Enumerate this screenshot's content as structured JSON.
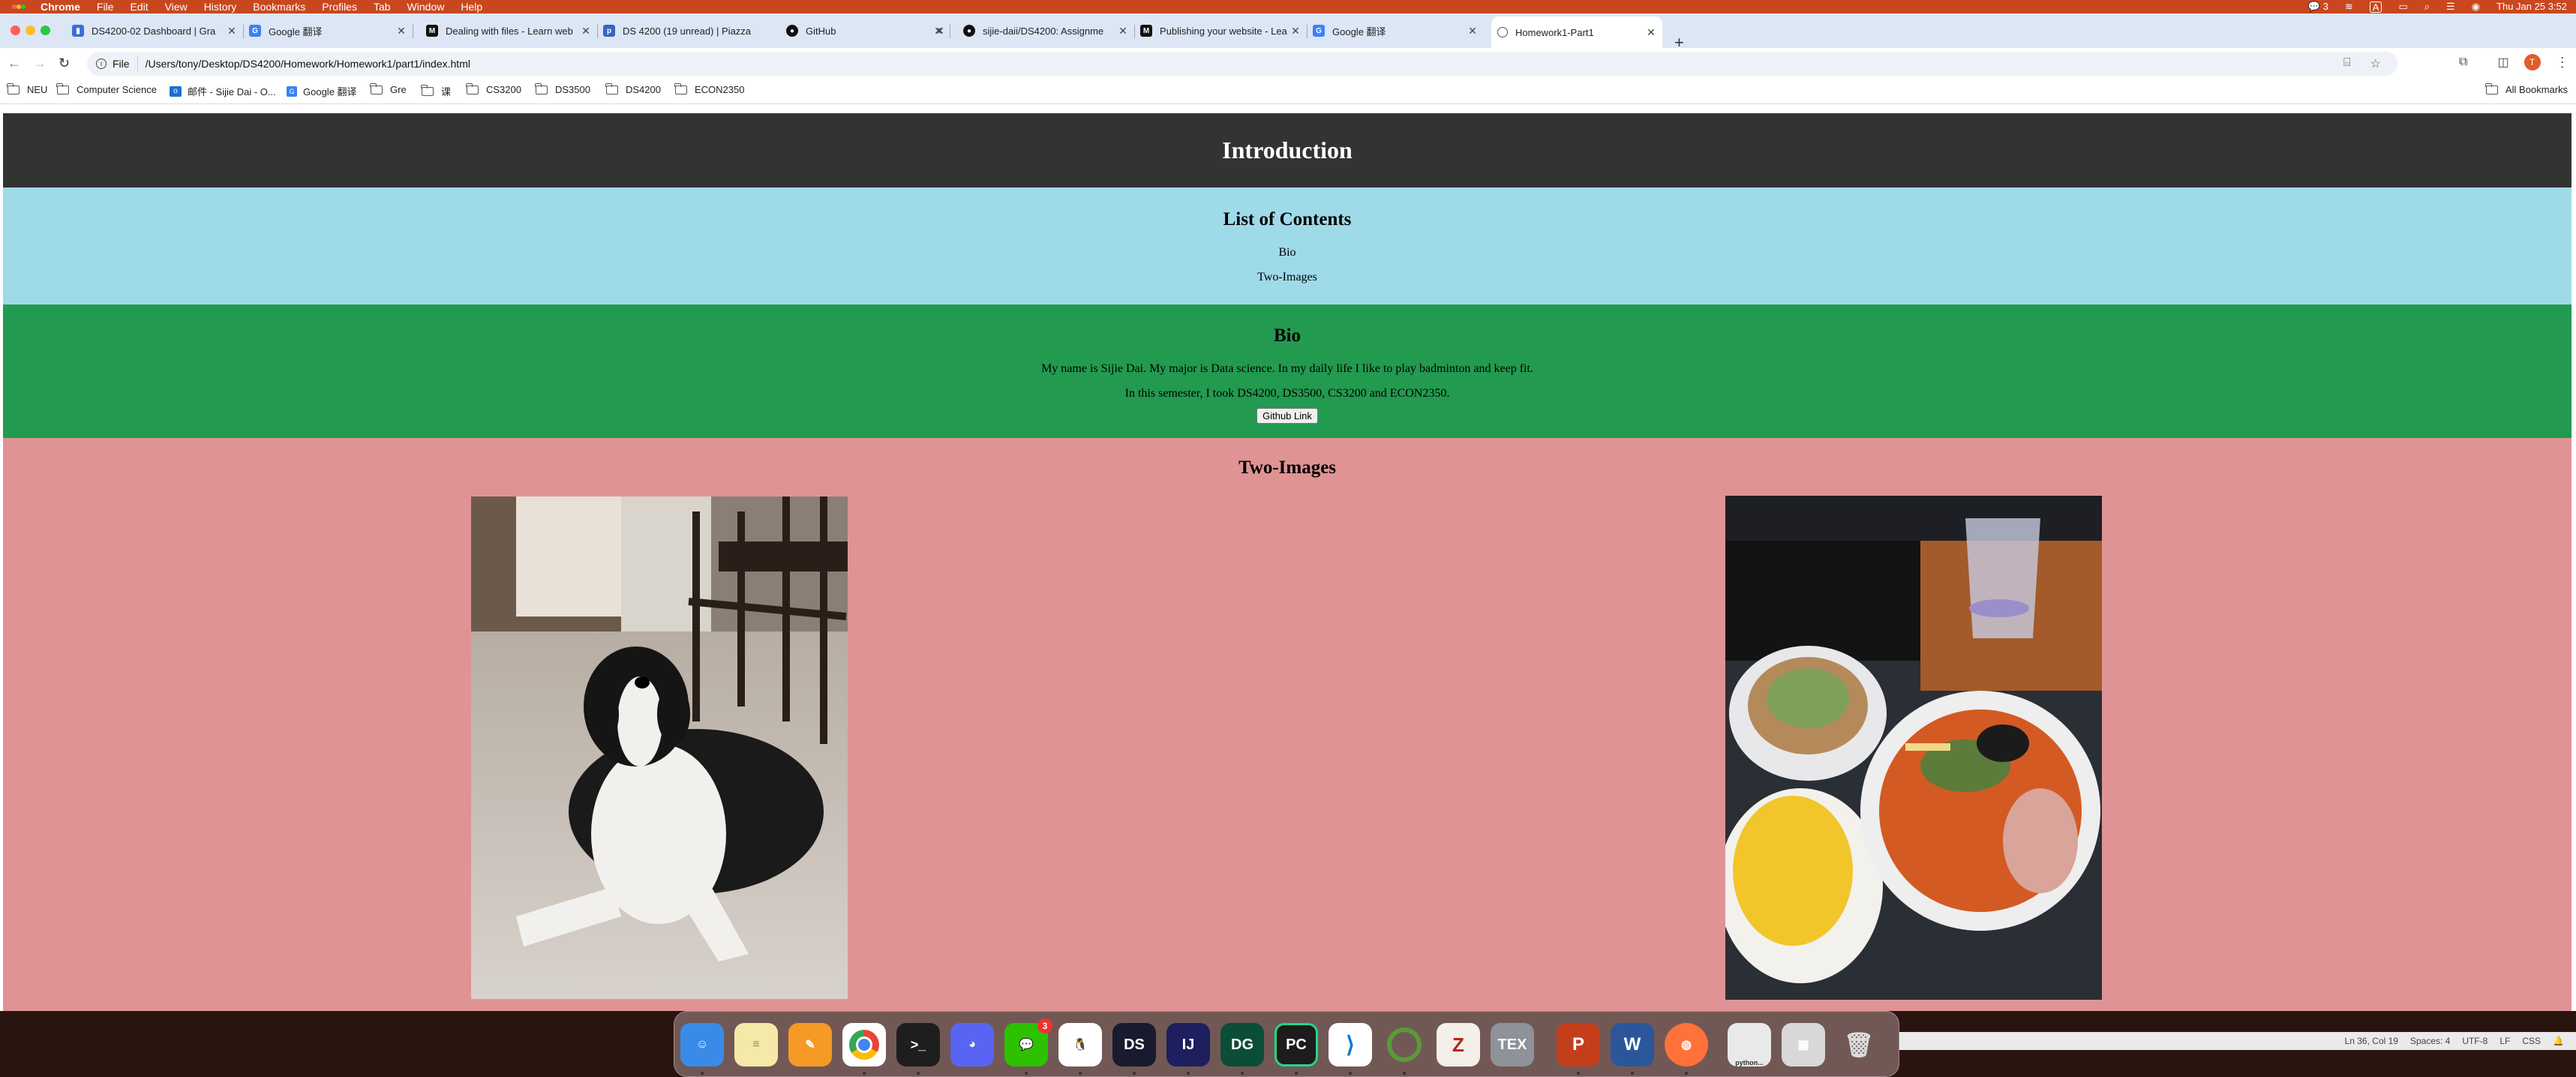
{
  "menubar": {
    "items": [
      "Chrome",
      "File",
      "Edit",
      "View",
      "History",
      "Bookmarks",
      "Profiles",
      "Tab",
      "Window",
      "Help"
    ],
    "wechat_count": "3",
    "input_method": "A",
    "clock": "Thu Jan 25  3:52"
  },
  "tabs": [
    {
      "title": "DS4200-02 Dashboard | Gra",
      "favicon": "chart-icon",
      "color": "#3b6fd6"
    },
    {
      "title": "Google 翻译",
      "favicon": "google-translate-icon",
      "color": "#3b82f6"
    },
    {
      "title": "Dealing with files - Learn web",
      "favicon": "mdn-icon",
      "color": "#111111"
    },
    {
      "title": "DS 4200 (19 unread) | Piazza",
      "favicon": "piazza-icon",
      "color": "#3566c4"
    },
    {
      "title": "GitHub",
      "favicon": "github-icon",
      "color": "#111111"
    },
    {
      "title": "sijie-daii/DS4200: Assignme",
      "favicon": "github-icon",
      "color": "#111111"
    },
    {
      "title": "Publishing your website - Lea",
      "favicon": "mdn-icon",
      "color": "#111111"
    },
    {
      "title": "Google 翻译",
      "favicon": "google-translate-icon",
      "color": "#3b82f6"
    },
    {
      "title": "Homework1-Part1",
      "favicon": "globe-icon",
      "color": "#555555",
      "active": true
    }
  ],
  "toolbar": {
    "scheme_label": "File",
    "url": "/Users/tony/Desktop/DS4200/Homework/Homework1/part1/index.html",
    "profile_initial": "T"
  },
  "bookmarks": {
    "items": [
      {
        "label": "NEU",
        "icon": "folder-icon"
      },
      {
        "label": "Computer Science",
        "icon": "folder-icon"
      },
      {
        "label": "邮件 - Sijie Dai - O...",
        "icon": "outlook-icon"
      },
      {
        "label": "Google 翻译",
        "icon": "google-translate-icon"
      },
      {
        "label": "Gre",
        "icon": "folder-icon"
      },
      {
        "label": "课",
        "icon": "folder-icon"
      },
      {
        "label": "CS3200",
        "icon": "folder-icon"
      },
      {
        "label": "DS3500",
        "icon": "folder-icon"
      },
      {
        "label": "DS4200",
        "icon": "folder-icon"
      },
      {
        "label": "ECON2350",
        "icon": "folder-icon"
      }
    ],
    "all_bookmarks": "All Bookmarks"
  },
  "page": {
    "intro_title": "Introduction",
    "contents_title": "List of Contents",
    "contents_links": [
      "Bio",
      "Two-Images"
    ],
    "bio_title": "Bio",
    "bio_line1": "My name is Sijie Dai. My major is Data science. In my daily life I like to play badminton and keep fit.",
    "bio_line2": "In this semester, I took DS4200, DS3500, CS3200 and ECON2350.",
    "github_button": "Github Link",
    "images_title": "Two-Images",
    "colors": {
      "intro": "#333331",
      "contents": "#9fdae9",
      "bio": "#229a4f",
      "images": "#e09394"
    }
  },
  "dock": {
    "apps": [
      "Finder",
      "Notes",
      "Pages",
      "Chrome",
      "Terminal",
      "Discord",
      "WeChat",
      "QQ",
      "DataSpell",
      "IntelliJ IDEA",
      "DataGrip",
      "PyCharm",
      "VS Code",
      "Lasso",
      "Zotero",
      "TeX",
      "PowerPoint",
      "Word",
      "Firefox",
      "python",
      "Window",
      "Trash"
    ],
    "wechat_badge": "3",
    "window_label": "python..."
  },
  "vscode_status": {
    "position": "Ln 36, Col 19",
    "spaces": "Spaces: 4",
    "encoding": "UTF-8",
    "eol": "LF",
    "language": "CSS"
  }
}
